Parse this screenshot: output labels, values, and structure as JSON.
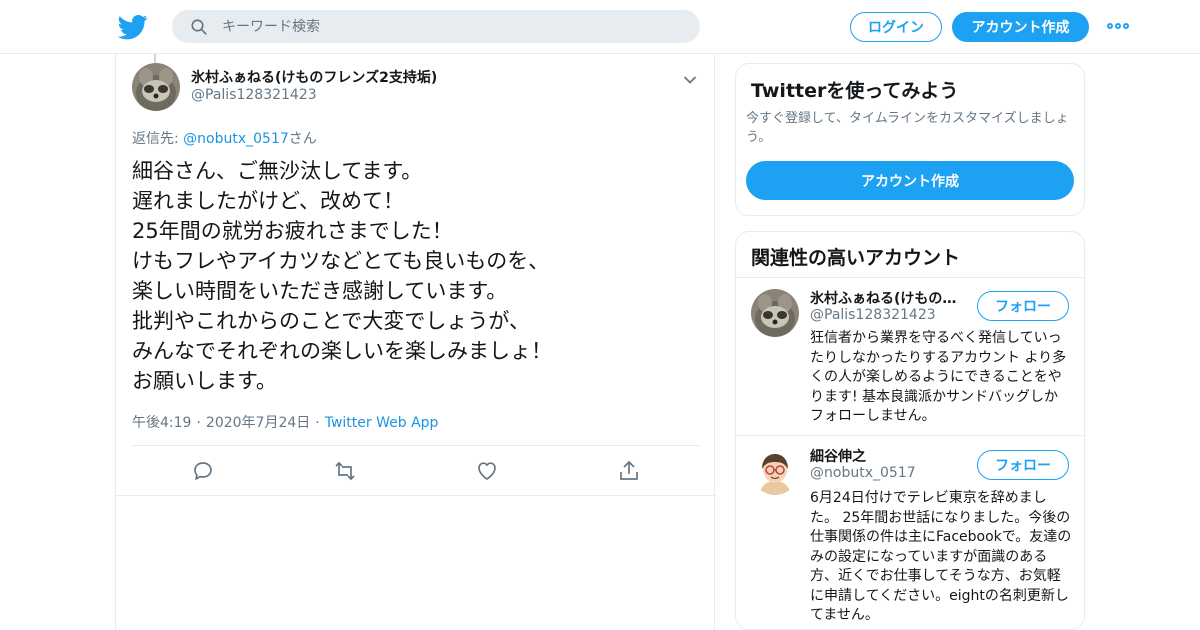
{
  "header": {
    "search_placeholder": "キーワード検索",
    "login_label": "ログイン",
    "signup_label": "アカウント作成",
    "brand_color": "#1da1f2"
  },
  "tweet": {
    "display_name": "氷村ふぁねる(けものフレンズ2支持垢)",
    "handle": "@Palis128321423",
    "reply_prefix": "返信先: ",
    "reply_handle": "@nobutx_0517",
    "reply_suffix": "さん",
    "text": "細谷さん、ご無沙汰してます。\n遅れましたがけど、改めて！\n25年間の就労お疲れさまでした！\nけもフレやアイカツなどとても良いものを、\n楽しい時間をいただき感謝しています。\n批判やこれからのことで大変でしょうが、\nみんなでそれぞれの楽しいを楽しみましょ！\nお願いします。",
    "time": "午後4:19",
    "date": "2020年7月24日",
    "separator": "·",
    "source": "Twitter Web App"
  },
  "signup_card": {
    "title": "Twitterを使ってみよう",
    "description": "今すぐ登録して、タイムラインをカスタマイズしましょう。",
    "cta": "アカウント作成"
  },
  "related": {
    "title": "関連性の高いアカウント",
    "follow_label": "フォロー",
    "accounts": [
      {
        "name": "氷村ふぁねる(けもの…",
        "handle": "@Palis128321423",
        "bio": "狂信者から業界を守るべく発信していったりしなかったりするアカウント より多くの人が楽しめるようにできることをやります! 基本良識派かサンドバッグしかフォローしません。"
      },
      {
        "name": "細谷伸之",
        "handle": "@nobutx_0517",
        "bio": "6月24日付けでテレビ東京を辞めました。 25年間お世話になりました。今後の仕事関係の件は主にFacebookで。友達のみの設定になっていますが面識のある方、近くでお仕事してそうな方、お気軽に申請してください。eightの名刺更新してません。"
      }
    ]
  }
}
